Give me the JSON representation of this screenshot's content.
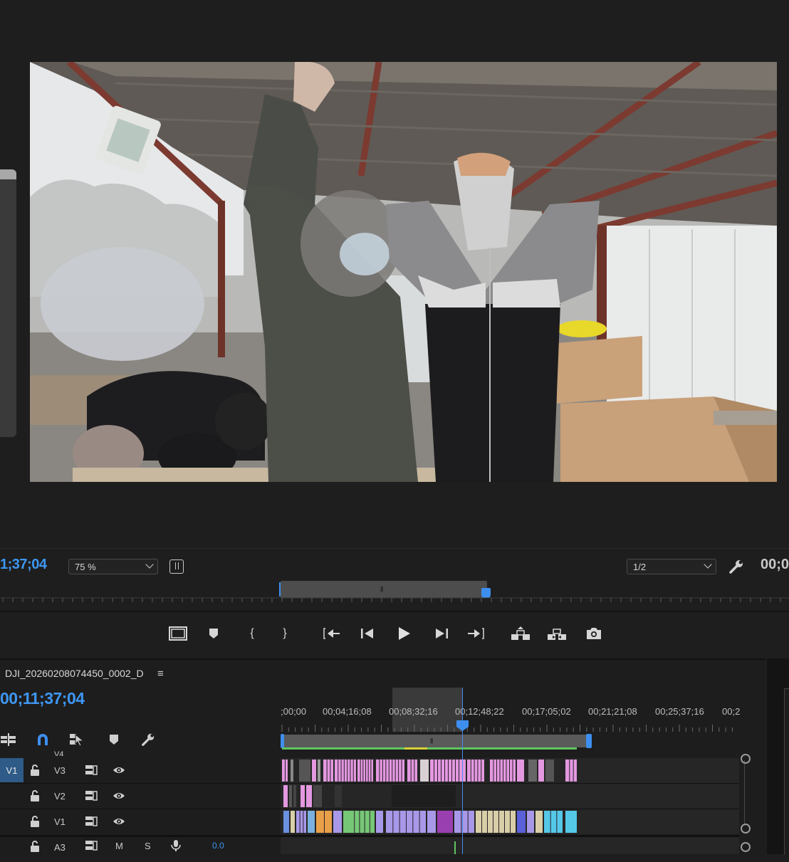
{
  "program_monitor": {
    "timecode": ";37;04",
    "timecode_prefix": "1",
    "zoom": "75 %",
    "resolution": "1/2",
    "duration_partial": "00;0"
  },
  "transport": {
    "buttons": [
      "safe-margins",
      "add-marker",
      "mark-in",
      "mark-out",
      "go-to-in",
      "step-back",
      "play",
      "step-forward",
      "go-to-out",
      "lift",
      "extract",
      "export-frame"
    ]
  },
  "timeline": {
    "sequence_name": "DJI_20260208074450_0002_D",
    "menu_glyph": "≡",
    "timecode": "00;11;37;04",
    "ruler_labels": [
      ";00;00",
      "00;04;16;08",
      "00;08;32;16",
      "00;12;48;22",
      "00;17;05;02",
      "00;21;21;08",
      "00;25;37;16",
      "00;2"
    ],
    "tracks": {
      "partial_label": "V4",
      "v3": {
        "source": "V1",
        "label": "V3"
      },
      "v2": {
        "label": "V2"
      },
      "v1": {
        "label": "V1"
      },
      "a3": {
        "label": "A3",
        "mute": "M",
        "solo": "S",
        "volume": "0.0"
      }
    }
  },
  "colors": {
    "accent": "#3e8ef0",
    "timecode_blue": "#3e97f3",
    "clip_pink": "#e398e0",
    "clip_green": "#76c776",
    "clip_lavender": "#a898e8",
    "clip_tan": "#d8cfa8",
    "clip_cyan": "#55c8e8",
    "clip_orange": "#e8a048",
    "clip_purple": "#9a3fb0",
    "clip_blue": "#5a60d8"
  }
}
